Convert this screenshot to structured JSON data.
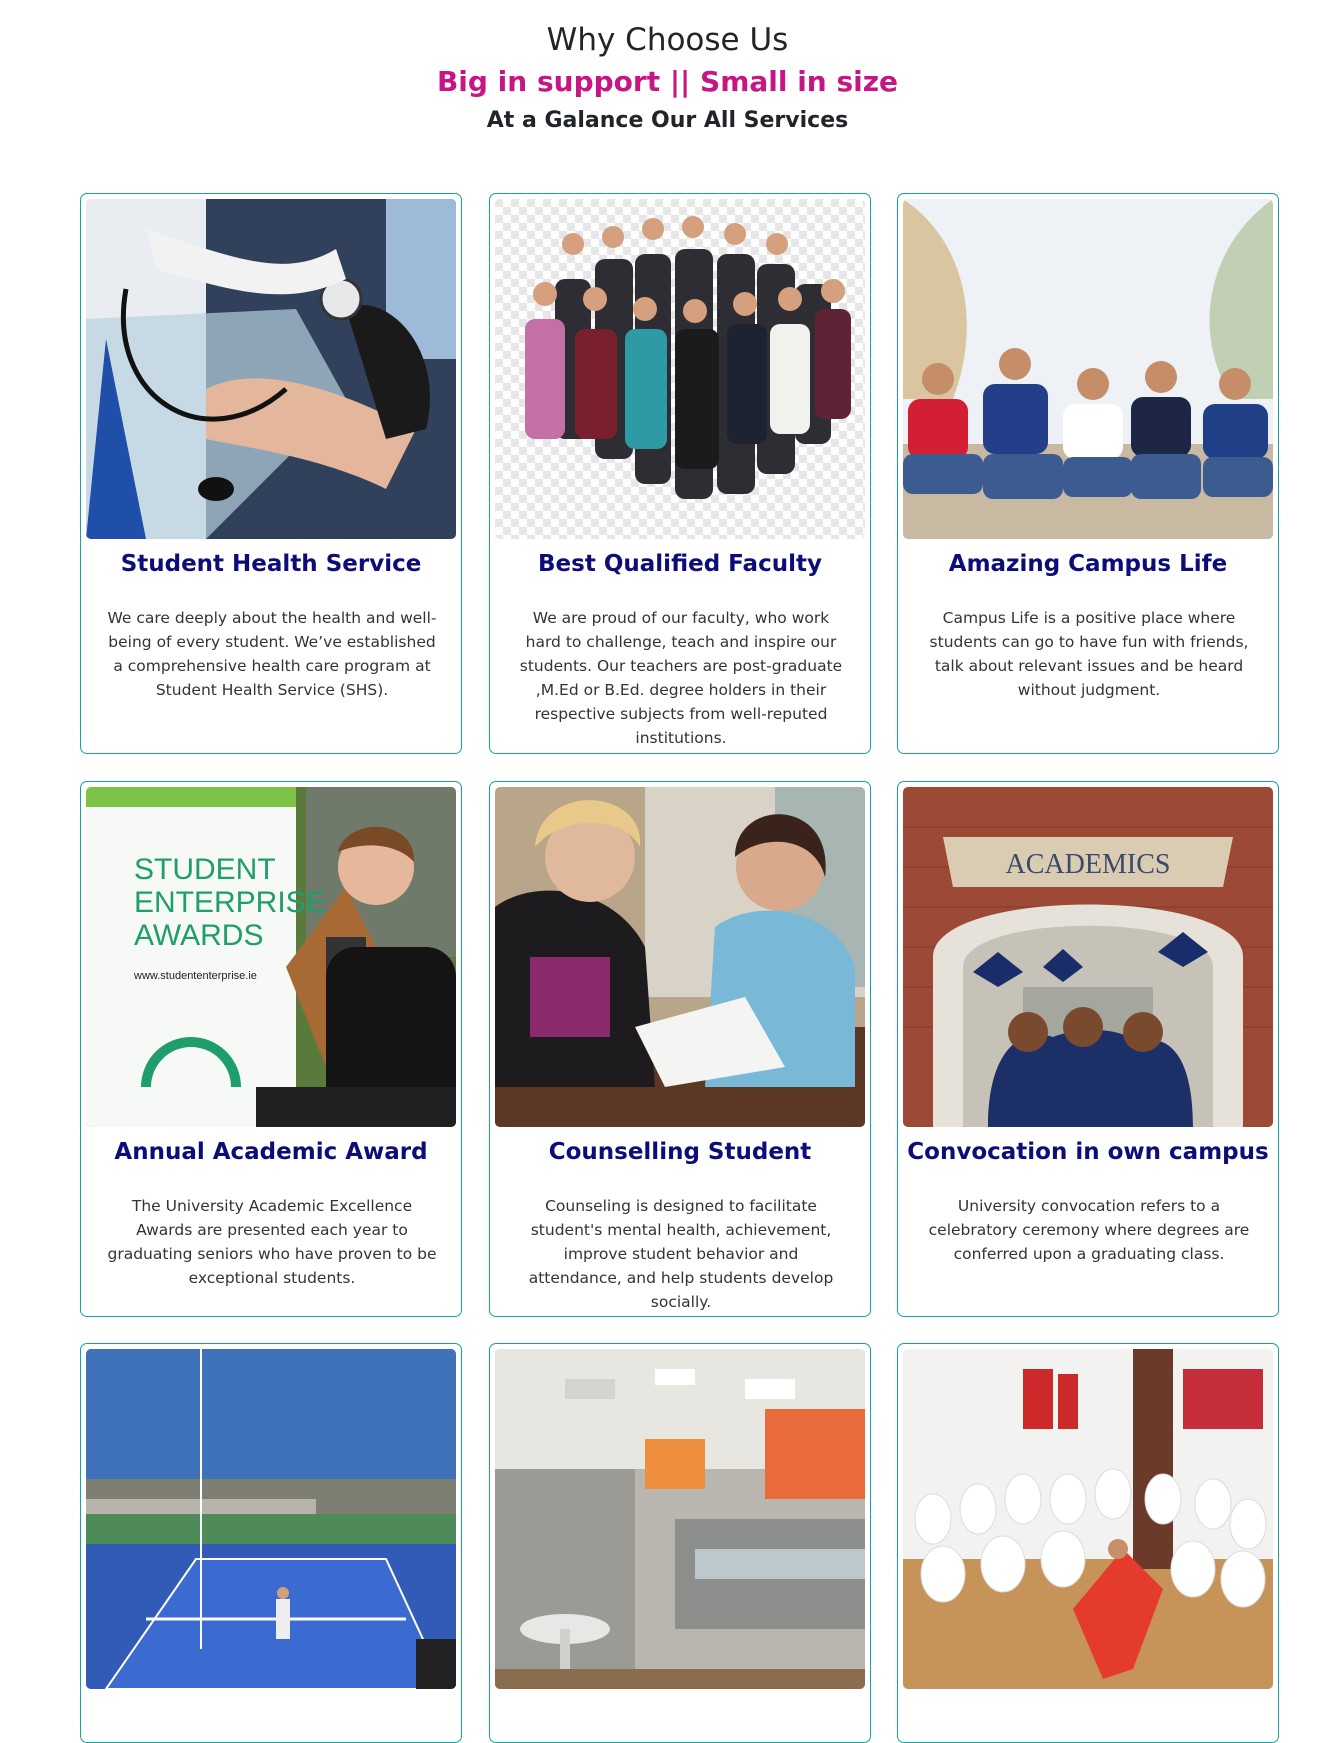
{
  "header": {
    "title": "Why Choose Us",
    "subtitle": "Big in support || Small in size",
    "tagline": "At a Galance Our All Services"
  },
  "colors": {
    "subtitle": "#c71585",
    "card_title": "#0d0d7a",
    "card_border": "#17a2a0"
  },
  "cards": [
    {
      "title": "Student Health Service",
      "text": "We care deeply about the health and well-being of every student. We’ve established a comprehensive health care program at Student Health Service (SHS).",
      "image": "blood-pressure-check-photo"
    },
    {
      "title": "Best Qualified Faculty",
      "text": "We are proud of our faculty, who work hard to challenge, teach and inspire our students. Our teachers are post-graduate ,M.Ed or B.Ed. degree holders in their respective subjects from well-reputed institutions.",
      "image": "faculty-group-photo"
    },
    {
      "title": "Amazing Campus Life",
      "text": "Campus Life is a positive place where students can go to have fun with friends, talk about relevant issues and be heard without judgment.",
      "image": "students-sitting-photo"
    },
    {
      "title": "Annual Academic Award",
      "text": "The University Academic Excellence Awards are presented each year to graduating seniors who have proven to be exceptional students.",
      "image": "award-student-photo",
      "image_text": [
        "STUDENT",
        "ENTERPRISE",
        "AWARDS",
        "www.studententerprise.ie"
      ]
    },
    {
      "title": "Counselling Student",
      "text": "Counseling is designed to facilitate student's mental health, achievement, improve student behavior and attendance, and help students develop socially.",
      "image": "counselling-session-photo"
    },
    {
      "title": "Convocation in own campus",
      "text": "University convocation refers to a celebratory ceremony where degrees are conferred upon a graduating class.",
      "image": "graduation-photo",
      "image_text": [
        "ACADEMICS"
      ]
    },
    {
      "title": "",
      "text": "",
      "image": "tennis-court-photo"
    },
    {
      "title": "",
      "text": "",
      "image": "cafeteria-photo"
    },
    {
      "title": "",
      "text": "",
      "image": "martial-arts-class-photo"
    }
  ]
}
